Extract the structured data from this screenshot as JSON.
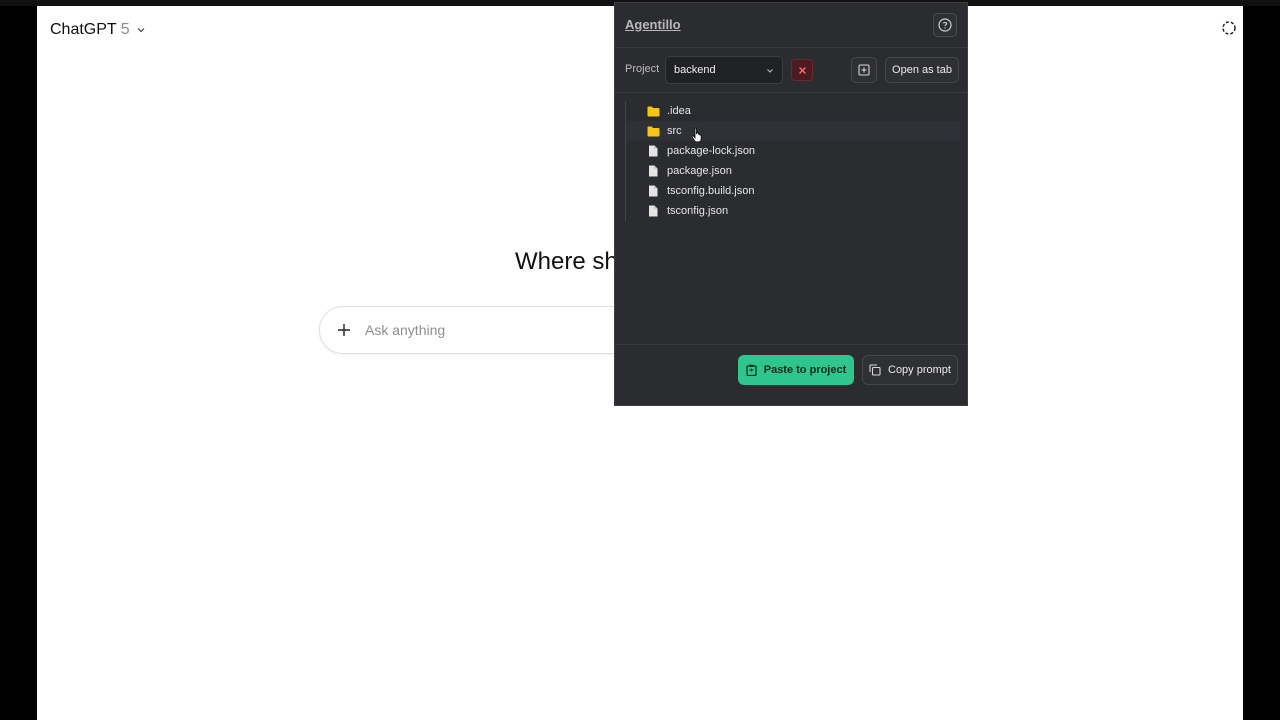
{
  "chatgpt": {
    "model_name": "ChatGPT",
    "model_version": "5",
    "heading": "Where sh",
    "composer": {
      "placeholder": "Ask anything"
    }
  },
  "panel": {
    "title": "Agentillo",
    "project_label": "Project",
    "project_selected": "backend",
    "open_tab_label": "Open as tab",
    "files": [
      {
        "name": ".idea",
        "type": "folder"
      },
      {
        "name": "src",
        "type": "folder"
      },
      {
        "name": "package-lock.json",
        "type": "file"
      },
      {
        "name": "package.json",
        "type": "file"
      },
      {
        "name": "tsconfig.build.json",
        "type": "file"
      },
      {
        "name": "tsconfig.json",
        "type": "file"
      }
    ],
    "paste_label": "Paste to project",
    "copy_label": "Copy prompt"
  },
  "colors": {
    "accent_green": "#2ec58f",
    "folder_yellow": "#f5c518",
    "panel_bg": "#2b2c2f",
    "danger": "#e0525a"
  },
  "icons": {
    "help": "help-circle-icon",
    "clear": "close-icon",
    "new": "plus-square-icon",
    "folder": "folder-icon",
    "file": "file-icon",
    "paste": "clipboard-icon",
    "copy": "copy-icon",
    "plus": "plus-icon",
    "chevron": "chevron-down-icon",
    "temp_chat": "temporary-chat-icon"
  }
}
